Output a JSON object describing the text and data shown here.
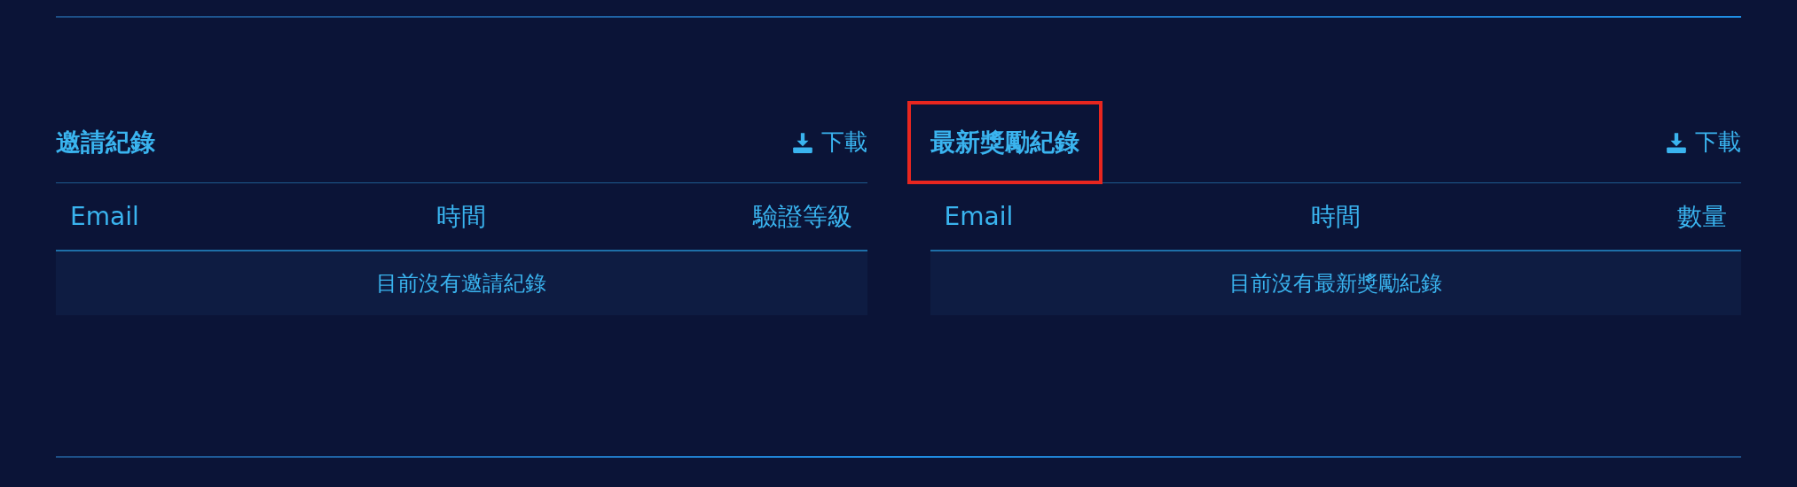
{
  "panels": [
    {
      "title": "邀請紀錄",
      "highlighted": false,
      "download": "下載",
      "columns": [
        "Email",
        "時間",
        "驗證等級"
      ],
      "empty_message": "目前沒有邀請紀錄"
    },
    {
      "title": "最新獎勵紀錄",
      "highlighted": true,
      "download": "下載",
      "columns": [
        "Email",
        "時間",
        "數量"
      ],
      "empty_message": "目前沒有最新獎勵紀錄"
    }
  ]
}
